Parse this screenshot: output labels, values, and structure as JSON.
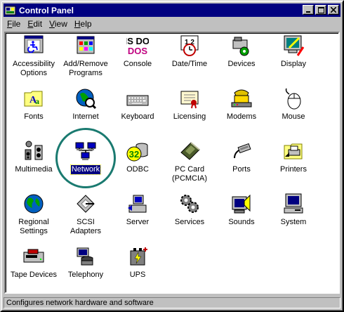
{
  "window": {
    "title": "Control Panel"
  },
  "menu": [
    {
      "text": "File",
      "ul": "F",
      "rest": "ile"
    },
    {
      "text": "Edit",
      "ul": "E",
      "rest": "dit"
    },
    {
      "text": "View",
      "ul": "V",
      "rest": "iew"
    },
    {
      "text": "Help",
      "ul": "H",
      "rest": "elp"
    }
  ],
  "icons": {
    "accessibility": "Accessibility\nOptions",
    "add_remove": "Add/Remove\nPrograms",
    "console": "Console",
    "date_time": "Date/Time",
    "devices": "Devices",
    "display": "Display",
    "fonts": "Fonts",
    "internet": "Internet",
    "keyboard": "Keyboard",
    "licensing": "Licensing",
    "modems": "Modems",
    "mouse": "Mouse",
    "multimedia": "Multimedia",
    "network": "Network",
    "odbc": "ODBC",
    "pc_card": "PC Card\n(PCMCIA)",
    "ports": "Ports",
    "printers": "Printers",
    "regional": "Regional\nSettings",
    "scsi": "SCSI Adapters",
    "server": "Server",
    "services": "Services",
    "sounds": "Sounds",
    "system": "System",
    "tape": "Tape Devices",
    "telephony": "Telephony",
    "ups": "UPS"
  },
  "icon_glyphs": {
    "console_text": "MS DOS",
    "date_text": "1 2",
    "odbc_text": "32"
  },
  "selected": "network",
  "status": "Configures network hardware and software",
  "colors": {
    "title_bar": "#000080",
    "desktop": "#008080",
    "selection": "#000080"
  }
}
